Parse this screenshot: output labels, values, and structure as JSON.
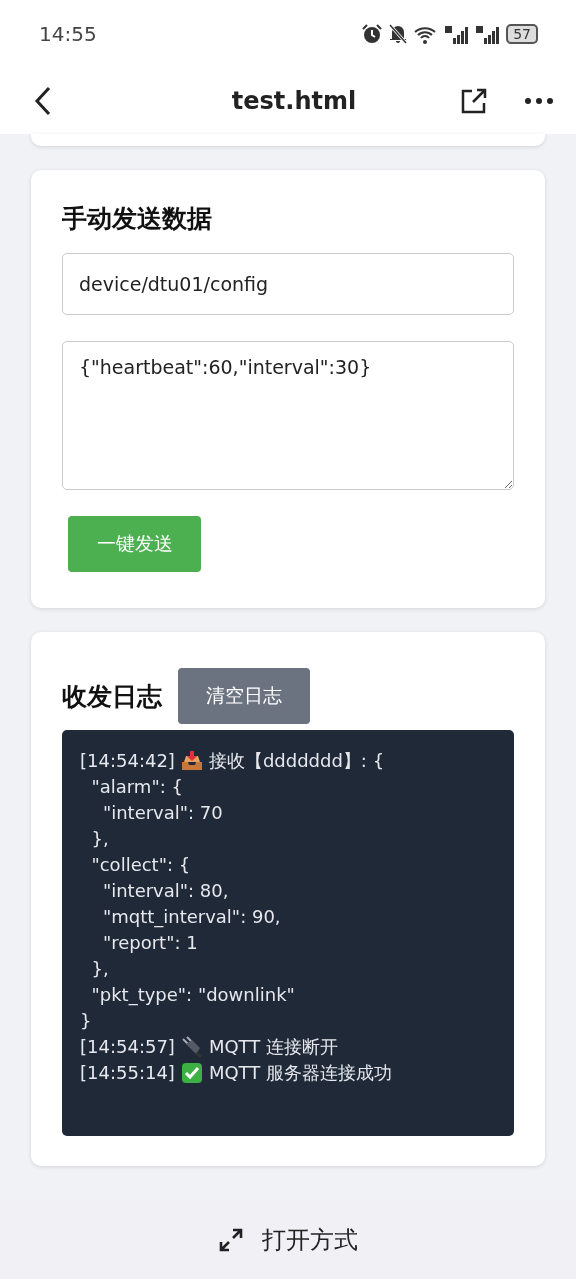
{
  "status_bar": {
    "time": "14:55",
    "battery": "57"
  },
  "header": {
    "title": "test.html"
  },
  "send_card": {
    "title": "手动发送数据",
    "topic": "device/dtu01/config",
    "payload": "{\"heartbeat\":60,\"interval\":30}",
    "button": "一键发送"
  },
  "log_card": {
    "title": "收发日志",
    "clear_button": "清空日志",
    "entries": [
      {
        "time": "[14:54:42]",
        "kind": "inbox",
        "message": "接收【ddddddd】: {",
        "body": [
          "  \"alarm\": {",
          "    \"interval\": 70",
          "  },",
          "  \"collect\": {",
          "    \"interval\": 80,",
          "    \"mqtt_interval\": 90,",
          "    \"report\": 1",
          "  },",
          "  \"pkt_type\": \"downlink\"",
          "}"
        ]
      },
      {
        "time": "[14:54:57]",
        "kind": "plug",
        "message": "MQTT 连接断开"
      },
      {
        "time": "[14:55:14]",
        "kind": "check",
        "message": "MQTT 服务器连接成功"
      }
    ]
  },
  "bottom_bar": {
    "label": "打开方式"
  }
}
